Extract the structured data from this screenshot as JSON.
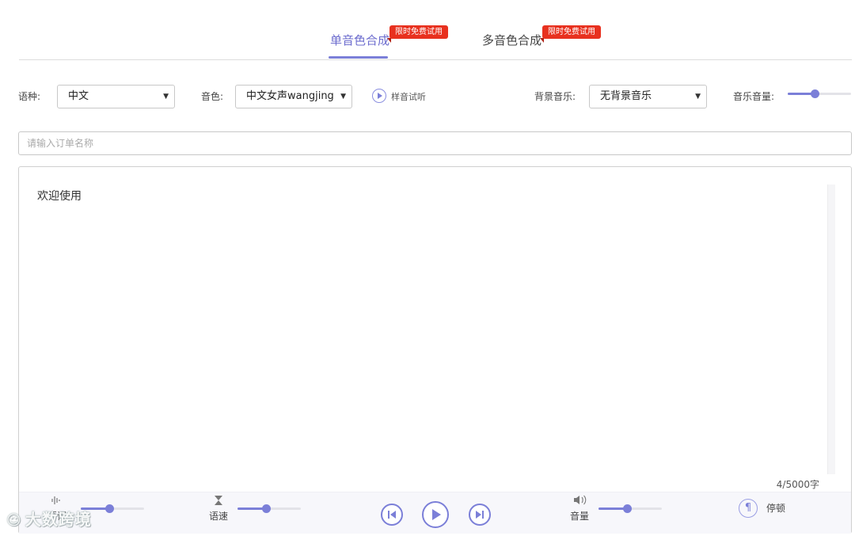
{
  "tabs": [
    {
      "label": "单音色合成",
      "badge": "限时免费试用",
      "active": true
    },
    {
      "label": "多音色合成",
      "badge": "限时免费试用",
      "active": false
    }
  ],
  "controls": {
    "language": {
      "label": "语种:",
      "value": "中文"
    },
    "voice": {
      "label": "音色:",
      "value": "中文女声wangjing"
    },
    "sample_listen": "样音试听",
    "bg_music": {
      "label": "背景音乐:",
      "value": "无背景音乐"
    },
    "music_volume": {
      "label": "音乐音量:",
      "level": 0.42
    }
  },
  "order_name": {
    "placeholder": "请输入订单名称",
    "value": ""
  },
  "editor": {
    "text": "欢迎使用",
    "counter": "4/5000字"
  },
  "toolbar": {
    "pitch": {
      "label": "语调",
      "level": 0.45
    },
    "speed": {
      "label": "语速",
      "level": 0.45
    },
    "volume": {
      "label": "音量",
      "level": 0.45
    },
    "pause": {
      "label": "停顿",
      "icon": "¶"
    }
  },
  "watermark": {
    "text": "大数跨境"
  },
  "colors": {
    "accent": "#7b7fd8",
    "badge": "#e8311f"
  }
}
